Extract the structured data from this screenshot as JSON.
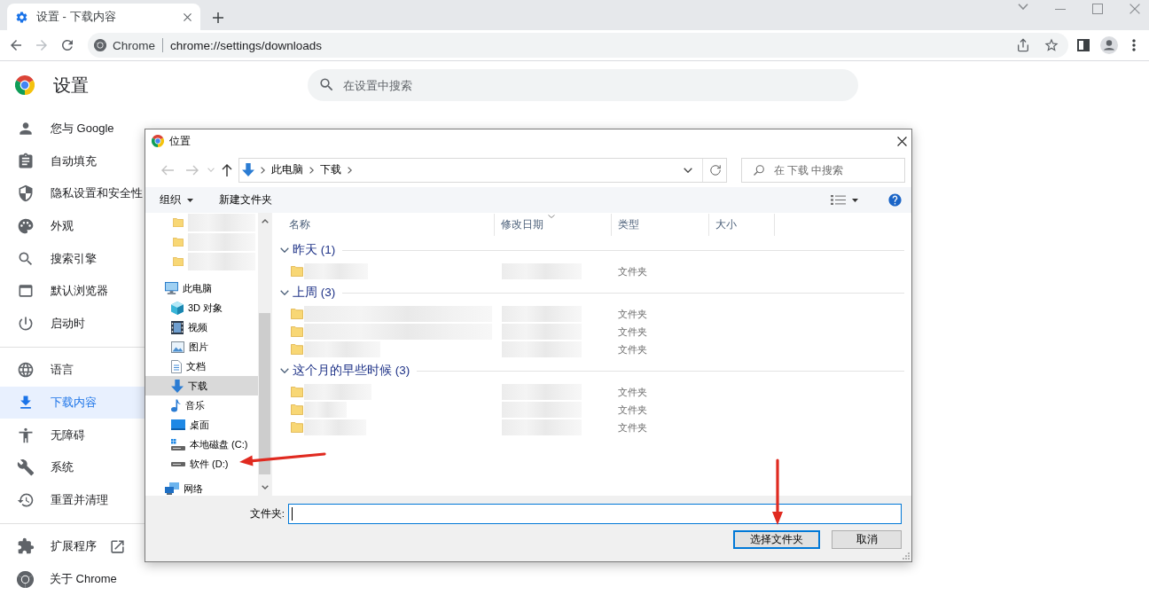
{
  "browser": {
    "tabs": [
      {
        "title": "设置 - 下载内容",
        "selected": true
      }
    ],
    "nav_buttons": [
      {
        "kind": "back",
        "disabled": false
      },
      {
        "kind": "forward",
        "disabled": true
      },
      {
        "kind": "reload",
        "disabled": false
      }
    ],
    "omnibox": {
      "site_label": "Chrome",
      "url": "chrome://settings/downloads"
    }
  },
  "settings": {
    "title": "设置",
    "search": {
      "placeholder": "在设置中搜索"
    },
    "sidebar": {
      "sections": [
        {
          "items": [
            {
              "label": "您与 Google",
              "selected": false,
              "external": false
            },
            {
              "label": "自动填充",
              "selected": false,
              "external": false
            },
            {
              "label": "隐私设置和安全性",
              "selected": false,
              "external": false
            },
            {
              "label": "外观",
              "selected": false,
              "external": false
            },
            {
              "label": "搜索引擎",
              "selected": false,
              "external": false
            },
            {
              "label": "默认浏览器",
              "selected": false,
              "external": false
            },
            {
              "label": "启动时",
              "selected": false,
              "external": false
            }
          ]
        },
        {
          "items": [
            {
              "label": "语言",
              "selected": false,
              "external": false
            },
            {
              "label": "下载内容",
              "selected": true,
              "external": false
            },
            {
              "label": "无障碍",
              "selected": false,
              "external": false
            },
            {
              "label": "系统",
              "selected": false,
              "external": false
            },
            {
              "label": "重置并清理",
              "selected": false,
              "external": false
            }
          ]
        },
        {
          "items": [
            {
              "label": "扩展程序",
              "selected": false,
              "external": true
            },
            {
              "label": "关于 Chrome",
              "selected": false,
              "external": false
            }
          ]
        }
      ]
    }
  },
  "dialog": {
    "title": "位置",
    "history_buttons": [
      {
        "kind": "back",
        "disabled": true
      },
      {
        "kind": "forward",
        "disabled": true
      },
      {
        "kind": "recent",
        "disabled": true
      },
      {
        "kind": "up",
        "disabled": false
      }
    ],
    "breadcrumb": [
      "此电脑",
      "下载"
    ],
    "search": {
      "placeholder": "在 下载 中搜索"
    },
    "toolbar": {
      "organize": "组织",
      "new_folder": "新建文件夹"
    },
    "nav_pane": {
      "items": [
        {
          "kind": "redacted",
          "selected": false
        },
        {
          "kind": "redacted",
          "selected": false
        },
        {
          "kind": "redacted",
          "selected": false
        },
        {
          "kind": "entry",
          "label": "此电脑",
          "selected": false,
          "children": [
            {
              "label": "3D 对象",
              "selected": false
            },
            {
              "label": "视频",
              "selected": false
            },
            {
              "label": "图片",
              "selected": false
            },
            {
              "label": "文档",
              "selected": false
            },
            {
              "label": "下载",
              "selected": true
            },
            {
              "label": "音乐",
              "selected": false
            },
            {
              "label": "桌面",
              "selected": false
            },
            {
              "label": "本地磁盘 (C:)",
              "selected": false
            },
            {
              "label": "软件 (D:)",
              "selected": false
            }
          ]
        },
        {
          "kind": "entry",
          "label": "网络",
          "selected": false
        }
      ]
    },
    "columns": [
      {
        "label": "名称",
        "sorted": false
      },
      {
        "label": "修改日期",
        "sorted": true
      },
      {
        "label": "类型",
        "sorted": false
      },
      {
        "label": "大小",
        "sorted": false
      }
    ],
    "groups": [
      {
        "label": "昨天 (1)",
        "expanded": true,
        "rows": [
          {
            "type": "文件夹"
          }
        ]
      },
      {
        "label": "上周 (3)",
        "expanded": true,
        "rows": [
          {
            "type": "文件夹"
          },
          {
            "type": "文件夹"
          },
          {
            "type": "文件夹"
          }
        ]
      },
      {
        "label": "这个月的早些时候 (3)",
        "expanded": true,
        "rows": [
          {
            "type": "文件夹"
          },
          {
            "type": "文件夹"
          },
          {
            "type": "文件夹"
          }
        ]
      }
    ],
    "folder_field": {
      "label": "文件夹:",
      "focused": true
    },
    "buttons": [
      {
        "label": "选择文件夹",
        "default": true
      },
      {
        "label": "取消",
        "default": false
      }
    ]
  },
  "annotations": [
    {
      "kind": "left-arrow"
    },
    {
      "kind": "down-arrow"
    }
  ]
}
